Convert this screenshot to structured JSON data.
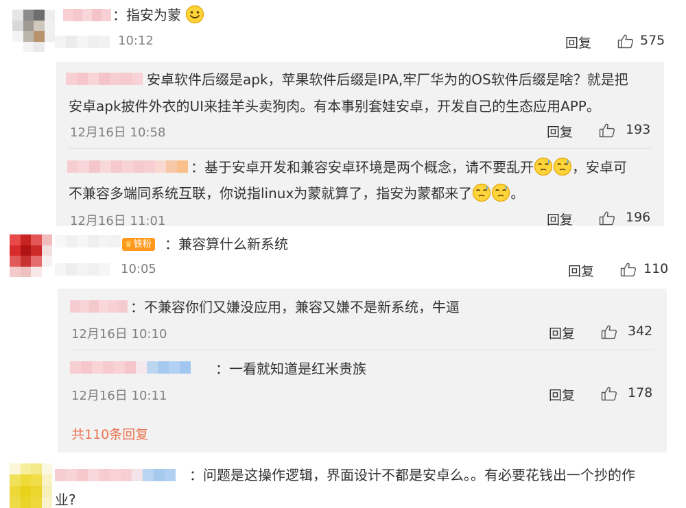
{
  "comments": [
    {
      "text": "：指安为蒙",
      "time": "10:12",
      "reply_label": "回复",
      "likes": "575",
      "replies": [
        {
          "text_line1": "安卓软件后缀是apk，苹果软件后缀是IPA,牢厂华为的OS软件后缀是啥？就是把",
          "text_line2": "安卓apk披件外衣的UI来挂羊头卖狗肉。有本事别套娃安卓，开发自己的生态应用APP。",
          "time": "12月16日 10:58",
          "reply_label": "回复",
          "likes": "193"
        },
        {
          "text_line1a": "：基于安卓开发和兼容安卓环境是两个概念，请不要乱开",
          "text_line1b": "，安卓可",
          "text_line2a": "不兼容多端同系统互联，你说指linux为蒙就算了，指安为蒙都来了",
          "text_line2b": "。",
          "time": "12月16日 11:01",
          "reply_label": "回复",
          "likes": "196"
        }
      ]
    },
    {
      "badge": "铁粉",
      "text": "：兼容算什么新系统",
      "time": "10:05",
      "reply_label": "回复",
      "likes": "110",
      "replies": [
        {
          "text": "：不兼容你们又嫌没应用，兼容又嫌不是新系统，牛逼",
          "time": "12月16日 10:10",
          "reply_label": "回复",
          "likes": "342"
        },
        {
          "text": "：一看就知道是红米贵族",
          "time": "12月16日 10:11",
          "reply_label": "回复",
          "likes": "178"
        }
      ],
      "more_label": "共110条回复"
    },
    {
      "text_line1": "：问题是这操作逻辑，界面设计不都是安卓么。。有必要花钱出一个抄的作",
      "text_line2": "业?"
    }
  ],
  "colors": {
    "link_orange": "#eb7350",
    "reply_bg": "#f2f2f2",
    "badge_orange": "#ff9a1f"
  },
  "icons": [
    "thumb-up-icon",
    "smile-emoji",
    "sweat-emoji",
    "crown-icon"
  ]
}
